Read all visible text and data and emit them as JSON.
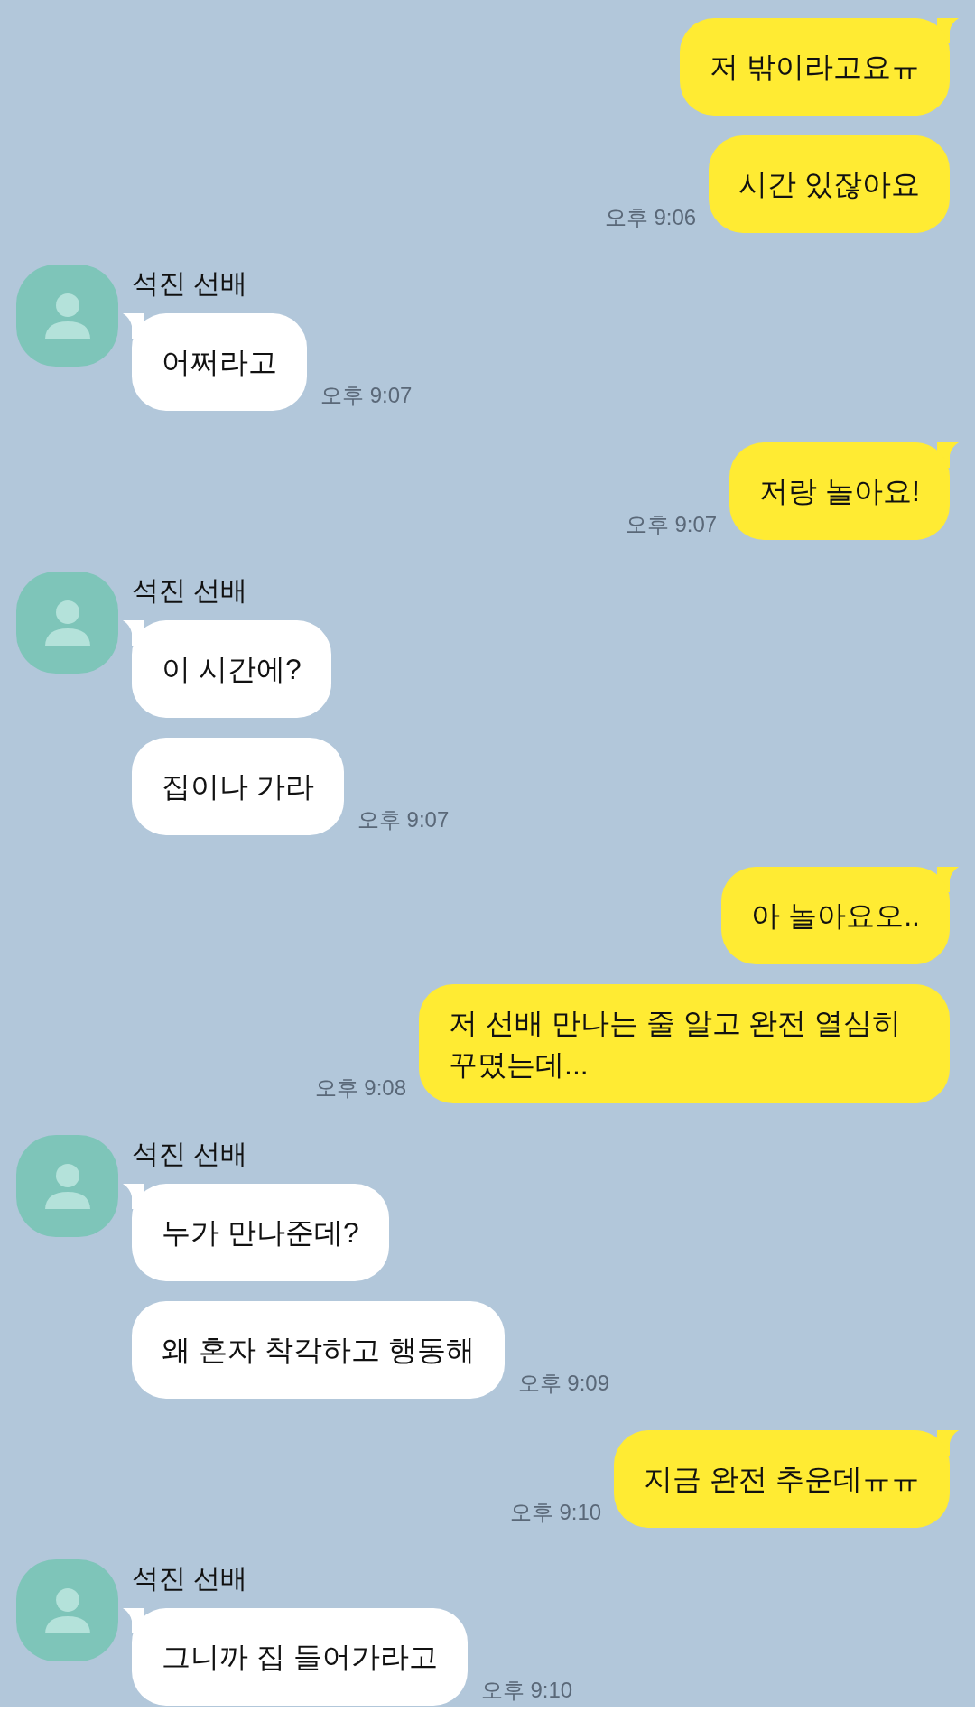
{
  "messages": [
    {
      "kind": "sent",
      "bubbles": [
        "저 밖이라고요ㅠ",
        "시간 있잖아요"
      ],
      "time": "오후 9:06"
    },
    {
      "kind": "received",
      "sender": "석진 선배",
      "bubbles": [
        "어쩌라고"
      ],
      "time": "오후 9:07"
    },
    {
      "kind": "sent",
      "bubbles": [
        "저랑 놀아요!"
      ],
      "time": "오후 9:07"
    },
    {
      "kind": "received",
      "sender": "석진 선배",
      "bubbles": [
        "이 시간에?",
        "집이나 가라"
      ],
      "time": "오후 9:07"
    },
    {
      "kind": "sent",
      "bubbles": [
        "아 놀아요오..",
        "저 선배 만나는 줄 알고 완전 열심히 꾸몄는데..."
      ],
      "time": "오후 9:08"
    },
    {
      "kind": "received",
      "sender": "석진 선배",
      "bubbles": [
        "누가 만나준데?",
        "왜 혼자 착각하고 행동해"
      ],
      "time": "오후 9:09"
    },
    {
      "kind": "sent",
      "bubbles": [
        "지금 완전 추운데ㅠㅠ"
      ],
      "time": "오후 9:10"
    },
    {
      "kind": "received",
      "sender": "석진 선배",
      "bubbles": [
        "그니까 집 들어가라고"
      ],
      "time": "오후 9:10"
    }
  ]
}
